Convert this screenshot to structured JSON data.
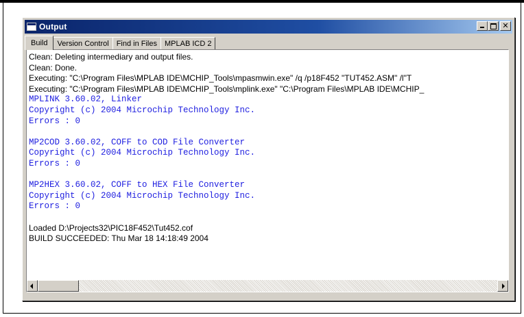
{
  "window": {
    "title": "Output",
    "buttons": [
      "minimize-icon",
      "maximize-icon",
      "close-icon"
    ]
  },
  "tabs": [
    {
      "label": "Build",
      "active": true
    },
    {
      "label": "Version Control",
      "active": false
    },
    {
      "label": "Find in Files",
      "active": false
    },
    {
      "label": "MPLAB ICD 2",
      "active": false
    }
  ],
  "output": {
    "lines": [
      {
        "text": "Clean: Deleting intermediary and output files.",
        "style": "sans"
      },
      {
        "text": "Clean: Done.",
        "style": "sans"
      },
      {
        "text": "Executing: \"C:\\Program Files\\MPLAB IDE\\MCHIP_Tools\\mpasmwin.exe\" /q /p18F452 \"TUT452.ASM\" /l\"T",
        "style": "sans"
      },
      {
        "text": "Executing: \"C:\\Program Files\\MPLAB IDE\\MCHIP_Tools\\mplink.exe\" \"C:\\Program Files\\MPLAB IDE\\MCHIP_",
        "style": "sans"
      },
      {
        "text": "MPLINK 3.60.02, Linker",
        "style": "mono"
      },
      {
        "text": "Copyright (c) 2004 Microchip Technology Inc.",
        "style": "mono"
      },
      {
        "text": "Errors    : 0",
        "style": "mono"
      },
      {
        "text": "",
        "style": "blank"
      },
      {
        "text": "MP2COD 3.60.02, COFF to COD File Converter",
        "style": "mono"
      },
      {
        "text": "Copyright (c) 2004 Microchip Technology Inc.",
        "style": "mono"
      },
      {
        "text": "Errors    : 0",
        "style": "mono"
      },
      {
        "text": "",
        "style": "blank"
      },
      {
        "text": "MP2HEX 3.60.02, COFF to HEX File Converter",
        "style": "mono"
      },
      {
        "text": "Copyright (c) 2004 Microchip Technology Inc.",
        "style": "mono"
      },
      {
        "text": "Errors    : 0",
        "style": "mono"
      },
      {
        "text": "",
        "style": "blank"
      },
      {
        "text": "Loaded D:\\Projects32\\PIC18F452\\Tut452.cof",
        "style": "sans"
      },
      {
        "text": "BUILD SUCCEEDED: Thu Mar 18 14:18:49 2004",
        "style": "sans"
      }
    ]
  },
  "colors": {
    "title_bar": "#0a246a",
    "compiler_output_text": "#2020e0",
    "plain_text": "#000000",
    "window_face": "#d4d0c8"
  }
}
